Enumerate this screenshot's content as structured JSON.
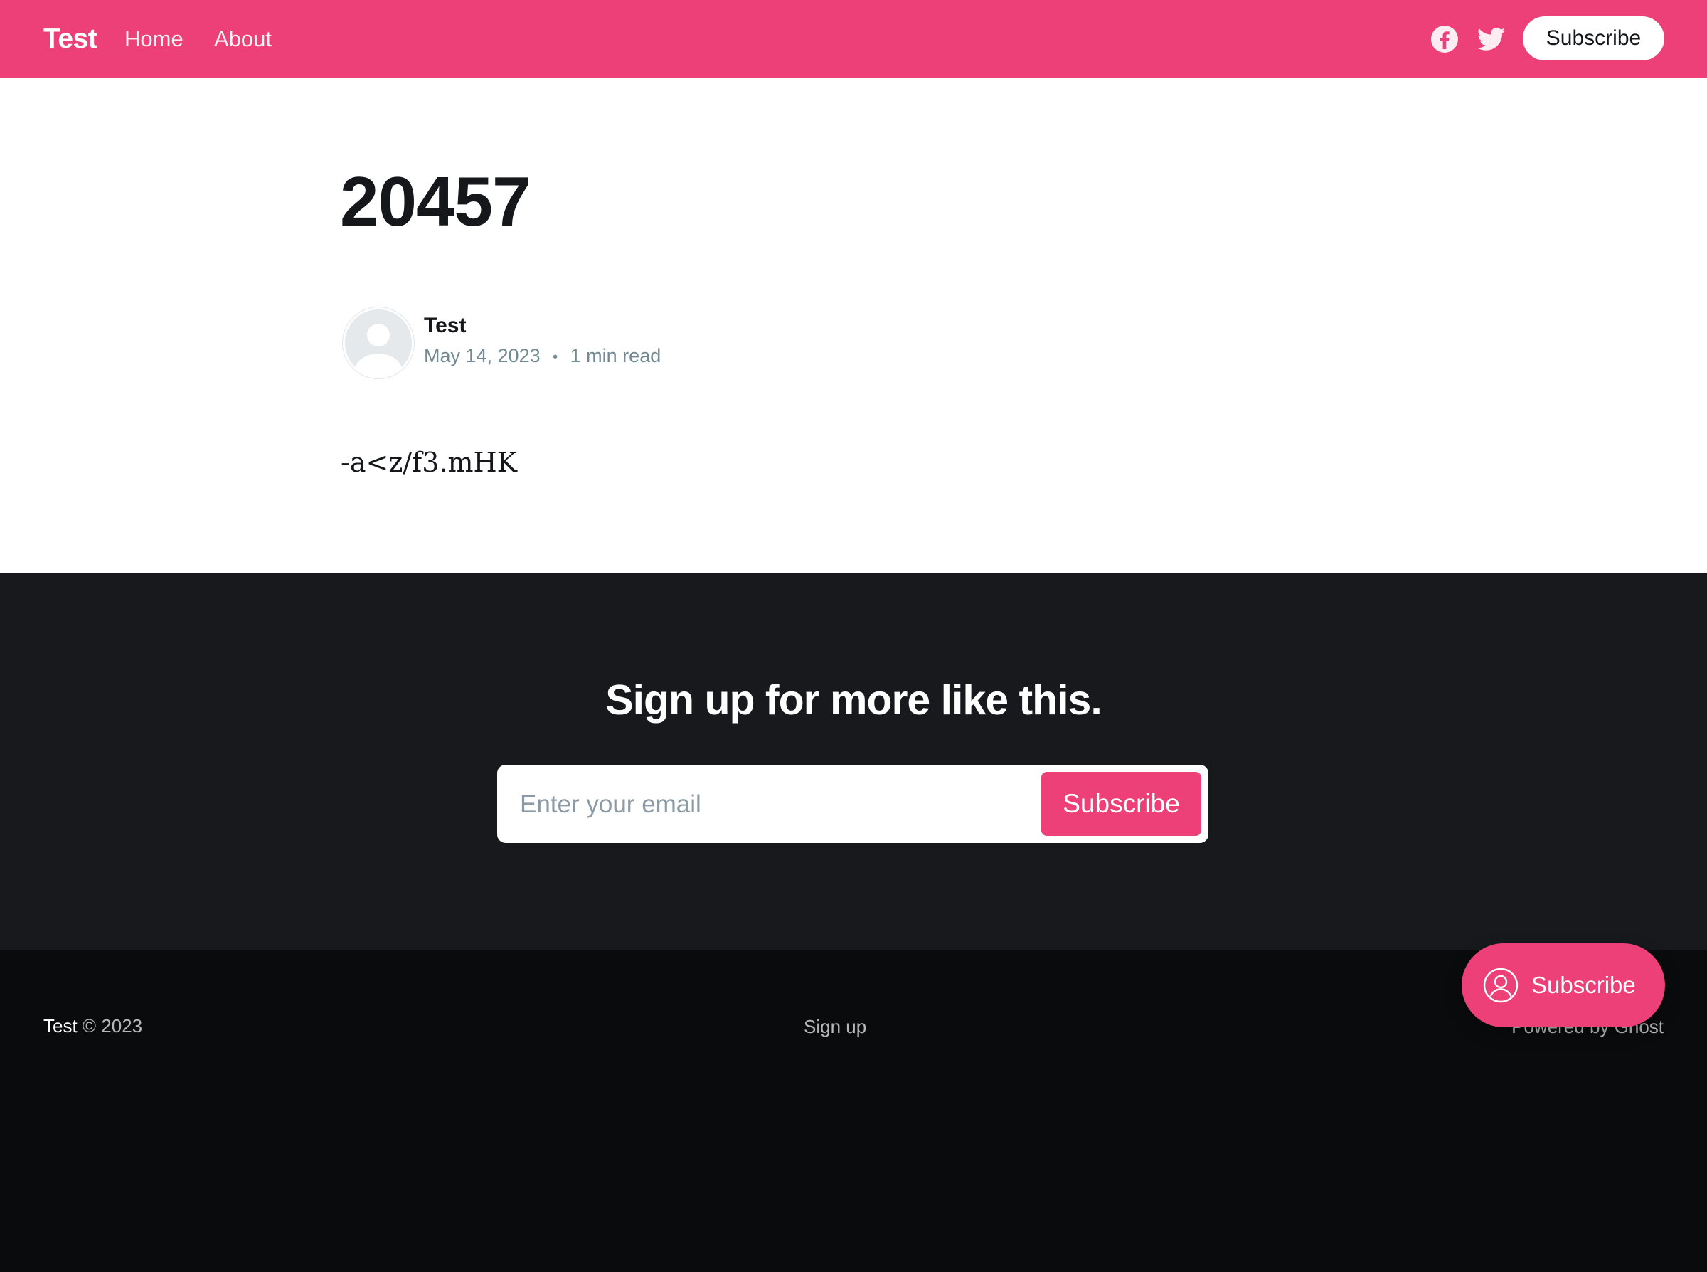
{
  "header": {
    "brand": "Test",
    "nav": [
      {
        "label": "Home"
      },
      {
        "label": "About"
      }
    ],
    "social": [
      {
        "icon": "facebook-icon"
      },
      {
        "icon": "twitter-icon"
      }
    ],
    "subscribe_label": "Subscribe",
    "accent_color": "#ed3f78"
  },
  "article": {
    "title": "20457",
    "author": "Test",
    "date": "May 14, 2023",
    "separator": "•",
    "reading_time": "1 min read",
    "body": "-a<z/f3.mHK"
  },
  "cta": {
    "heading": "Sign up for more like this.",
    "email_placeholder": "Enter your email",
    "button_label": "Subscribe"
  },
  "footer": {
    "brand": "Test",
    "copyright": "© 2023",
    "signup_label": "Sign up",
    "powered_by": "Powered by Ghost"
  },
  "portal": {
    "label": "Subscribe",
    "icon": "user-circle-icon"
  }
}
